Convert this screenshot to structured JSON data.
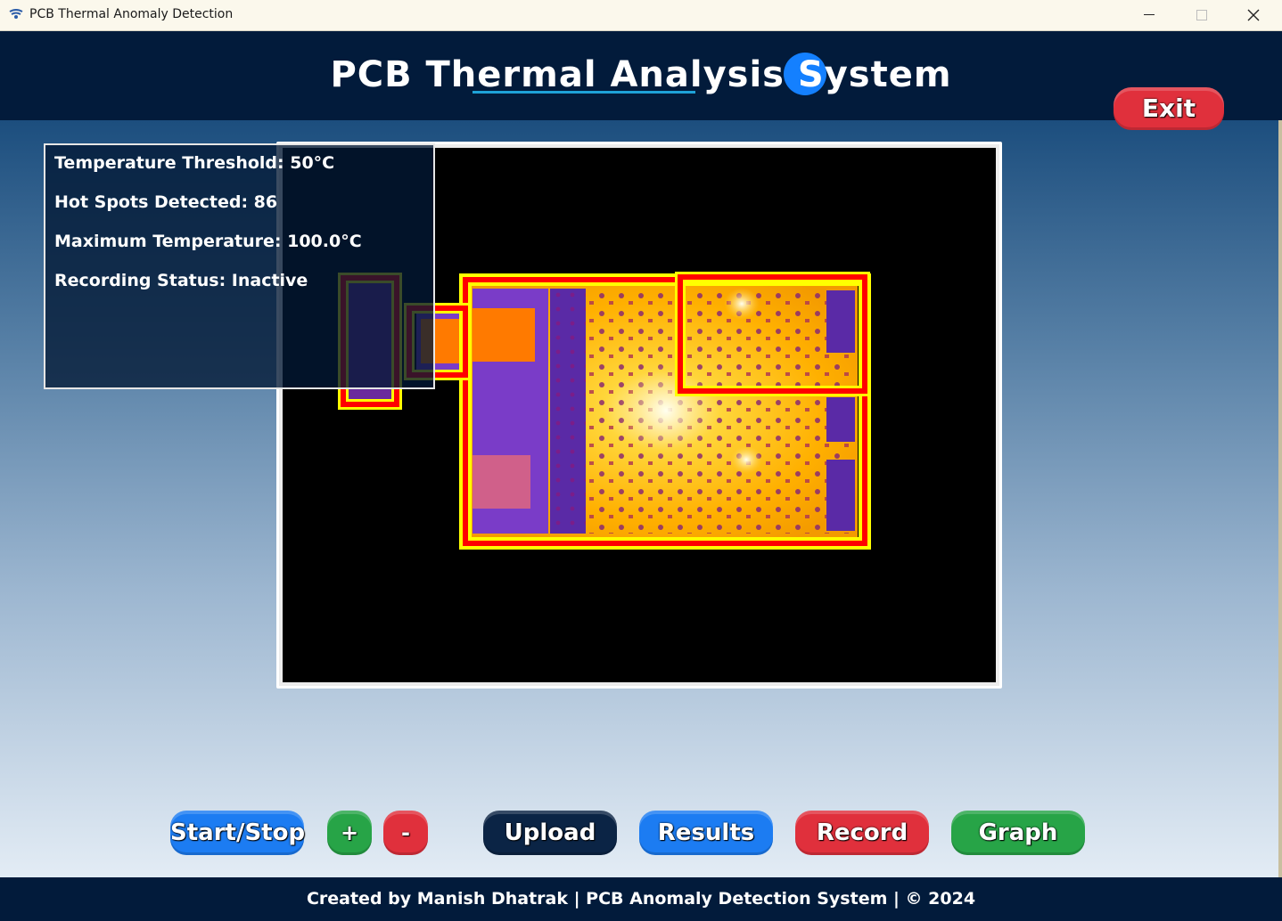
{
  "window": {
    "title": "PCB Thermal Anomaly Detection",
    "app_icon": "app-icon"
  },
  "header": {
    "title": "PCB Thermal Analysis System",
    "exit_label": "Exit"
  },
  "info": {
    "threshold": "Temperature Threshold: 50°C",
    "hot_spots": "Hot Spots Detected: 86",
    "max_temp": "Maximum Temperature: 100.0°C",
    "recording": "Recording Status: Inactive"
  },
  "controls": {
    "start_stop": "Start/Stop",
    "plus": "+",
    "minus": "-",
    "upload": "Upload",
    "results": "Results",
    "record": "Record",
    "graph": "Graph"
  },
  "footer": {
    "credit": "Created by Manish Dhatrak | PCB Anomaly Detection System | © 2024"
  },
  "colors": {
    "header_bg": "#021b3b",
    "blue_button": "#1c7cf2",
    "red_button": "#e0303c",
    "green_button": "#27a447",
    "dark_button": "#0b2445",
    "hotspot_box": "#ff0000",
    "hotspot_outline": "#ffff00"
  }
}
